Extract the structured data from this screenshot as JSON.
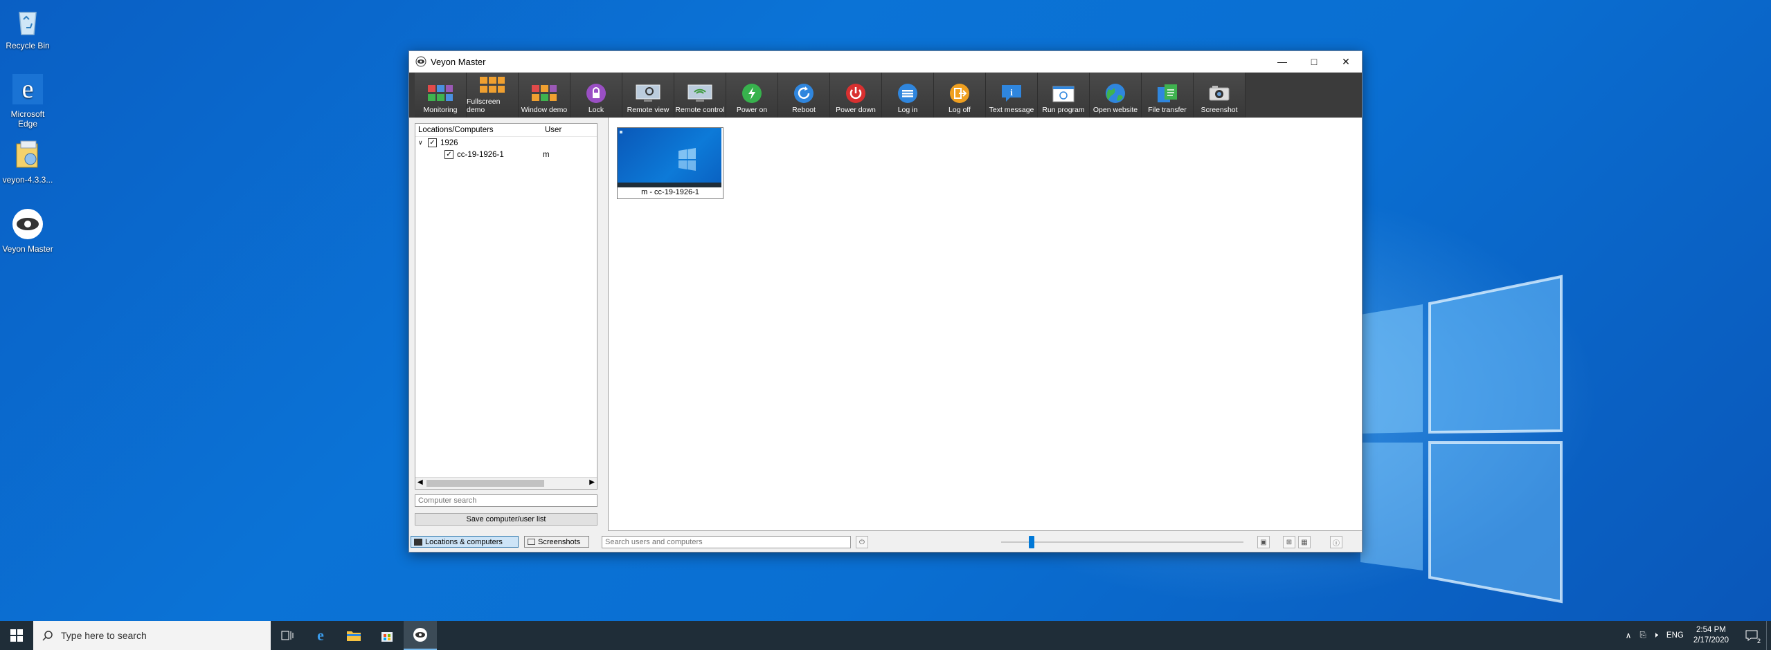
{
  "desktop": {
    "icons": [
      {
        "label": "Recycle Bin"
      },
      {
        "label": "Microsoft Edge"
      },
      {
        "label": "veyon-4.3.3..."
      },
      {
        "label": "Veyon Master"
      }
    ]
  },
  "window": {
    "title": "Veyon Master",
    "toolbar": [
      {
        "label": "Monitoring",
        "icon": "monitoring-icon"
      },
      {
        "label": "Fullscreen demo",
        "icon": "fullscreen-demo-icon"
      },
      {
        "label": "Window demo",
        "icon": "window-demo-icon"
      },
      {
        "label": "Lock",
        "icon": "lock-icon"
      },
      {
        "label": "Remote view",
        "icon": "remote-view-icon"
      },
      {
        "label": "Remote control",
        "icon": "remote-control-icon"
      },
      {
        "label": "Power on",
        "icon": "power-on-icon"
      },
      {
        "label": "Reboot",
        "icon": "reboot-icon"
      },
      {
        "label": "Power down",
        "icon": "power-down-icon"
      },
      {
        "label": "Log in",
        "icon": "log-in-icon"
      },
      {
        "label": "Log off",
        "icon": "log-off-icon"
      },
      {
        "label": "Text message",
        "icon": "text-message-icon"
      },
      {
        "label": "Run program",
        "icon": "run-program-icon"
      },
      {
        "label": "Open website",
        "icon": "open-website-icon"
      },
      {
        "label": "File transfer",
        "icon": "file-transfer-icon"
      },
      {
        "label": "Screenshot",
        "icon": "screenshot-icon"
      }
    ],
    "tree": {
      "col_location": "Locations/Computers",
      "col_user": "User",
      "location": "1926",
      "computer": "cc-19-1926-1",
      "computer_user": "m"
    },
    "computer_search_placeholder": "Computer search",
    "save_list_label": "Save computer/user list",
    "tile_label": "m - cc-19-1926-1",
    "status": {
      "tab_locations": "Locations & computers",
      "tab_screenshots": "Screenshots",
      "search_placeholder": "Search users and computers"
    }
  },
  "taskbar": {
    "search_placeholder": "Type here to search",
    "language": "ENG",
    "time": "2:54 PM",
    "date": "2/17/2020",
    "notification_count": "2"
  },
  "colors": {
    "desktop_blue": "#0b6fd4",
    "toolbar_bg": "#3b3b3b",
    "accent": "#0078d7"
  }
}
